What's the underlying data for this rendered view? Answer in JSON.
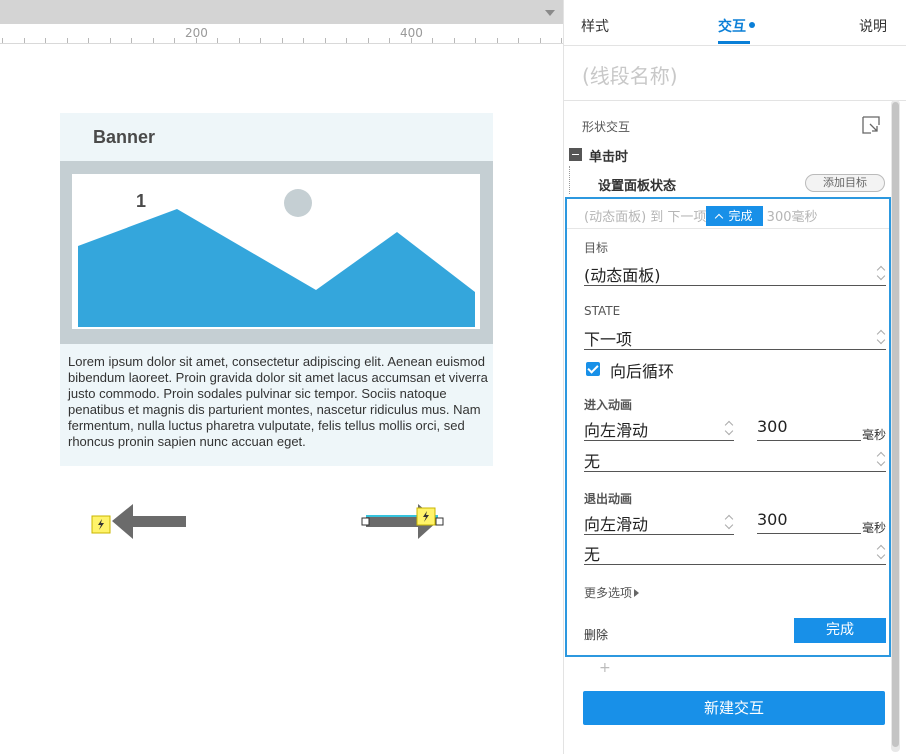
{
  "ruler": {
    "labels": [
      "200",
      "400"
    ]
  },
  "banner": {
    "title": "Banner",
    "slide_number": "1",
    "body_text": "Lorem ipsum dolor sit amet, consectetur adipiscing elit. Aenean euismod bibendum laoreet. Proin gravida dolor sit amet lacus accumsan et viverra justo commodo. Proin sodales pulvinar sic tempor. Sociis natoque penatibus et magnis dis parturient montes, nascetur ridiculus mus. Nam fermentum, nulla luctus pharetra vulputate, felis tellus mollis orci, sed rhoncus pronin sapien nunc accuan eget."
  },
  "colors": {
    "accent": "#1890e8",
    "mountain": "#34a6dc",
    "frame": "#c5cfd3",
    "banner_bg": "#eef6f9"
  },
  "tabs": {
    "style": "样式",
    "interact": "交互",
    "notes": "说明"
  },
  "panel": {
    "segment_name_placeholder": "(线段名称)",
    "shape_interaction": "形状交互",
    "event": "单击时",
    "action": "设置面板状态",
    "add_target": "添加目标",
    "summary": "(动态面板) 到 下一项 向左滑动 300毫秒",
    "summary_done": "完成",
    "target_label": "目标",
    "target_value": "(动态面板)",
    "state_label": "STATE",
    "state_value": "下一项",
    "loop_label": "向后循环",
    "loop_checked": true,
    "enter_label": "进入动画",
    "enter_anim": "向左滑动",
    "enter_duration": "300",
    "enter_unit": "毫秒",
    "enter_easing": "无",
    "exit_label": "退出动画",
    "exit_anim": "向左滑动",
    "exit_duration": "300",
    "exit_unit": "毫秒",
    "exit_easing": "无",
    "more_options": "更多选项",
    "delete": "删除",
    "done": "完成",
    "add_plus": "+",
    "new_interaction": "新建交互"
  }
}
